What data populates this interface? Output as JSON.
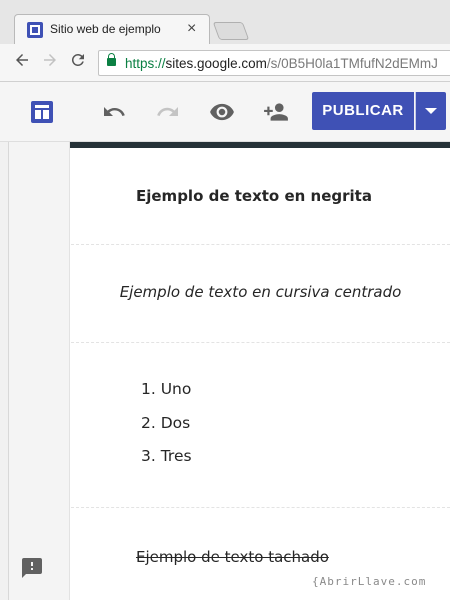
{
  "browser": {
    "tab_title": "Sitio web de ejemplo",
    "tab_close": "×",
    "url_scheme": "https://",
    "url_host": "sites.google.com",
    "url_path": "/s/0B5H0la1TMfufN2dEMmJ"
  },
  "icons": {
    "back": "arrow-left-icon",
    "forward": "arrow-right-icon",
    "reload": "reload-icon",
    "lock": "lock-icon",
    "layout": "page-layout-icon",
    "undo": "undo-icon",
    "redo": "redo-icon",
    "preview": "eye-icon",
    "share": "add-person-icon",
    "menu": "chevron-down-icon",
    "feedback": "feedback-icon"
  },
  "toolbar": {
    "publish_label": "PUBLICAR"
  },
  "content": {
    "bold_text": "Ejemplo de texto en negrita",
    "italic_text": "Ejemplo de texto en cursiva centrado",
    "list_items": [
      "1. Uno",
      "2. Dos",
      "3. Tres"
    ],
    "strike_text": "Ejemplo de texto tachado"
  },
  "watermark": "{AbrirLlave.com",
  "colors": {
    "brand": "#3f51b5",
    "accent_bar": "#263238",
    "secure": "#0b8043"
  }
}
